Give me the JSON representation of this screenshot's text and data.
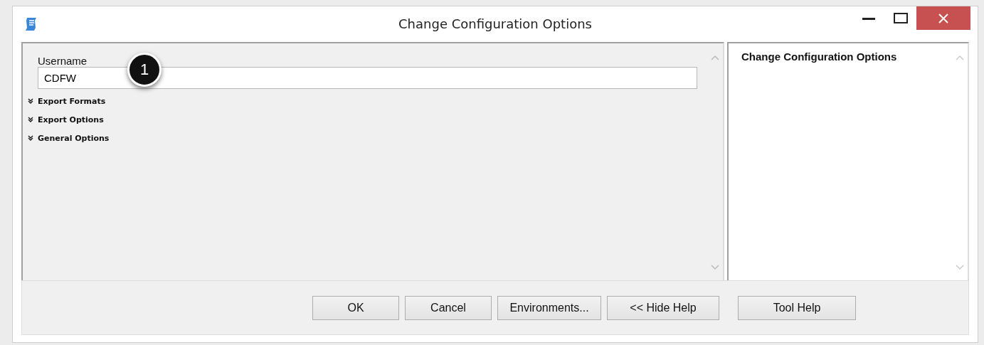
{
  "window": {
    "title": "Change Configuration Options"
  },
  "form": {
    "field": {
      "label": "Username",
      "value": "CDFW"
    },
    "sections": [
      {
        "label": "Export Formats",
        "expanded": false
      },
      {
        "label": "Export Options",
        "expanded": false
      },
      {
        "label": "General Options",
        "expanded": false
      }
    ]
  },
  "help_panel": {
    "title": "Change Configuration Options"
  },
  "callout": "1",
  "buttons": [
    {
      "label": "OK"
    },
    {
      "label": "Cancel"
    },
    {
      "label": "Environments..."
    },
    {
      "label": "<< Hide Help"
    },
    {
      "label": "Tool Help"
    }
  ]
}
